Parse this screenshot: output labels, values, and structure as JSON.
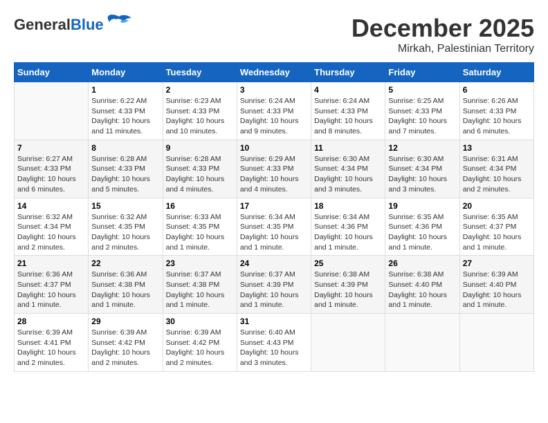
{
  "header": {
    "logo_general": "General",
    "logo_blue": "Blue",
    "main_title": "December 2025",
    "sub_title": "Mirkah, Palestinian Territory"
  },
  "calendar": {
    "days_of_week": [
      "Sunday",
      "Monday",
      "Tuesday",
      "Wednesday",
      "Thursday",
      "Friday",
      "Saturday"
    ],
    "weeks": [
      [
        {
          "day": "",
          "info": ""
        },
        {
          "day": "1",
          "info": "Sunrise: 6:22 AM\nSunset: 4:33 PM\nDaylight: 10 hours and 11 minutes."
        },
        {
          "day": "2",
          "info": "Sunrise: 6:23 AM\nSunset: 4:33 PM\nDaylight: 10 hours and 10 minutes."
        },
        {
          "day": "3",
          "info": "Sunrise: 6:24 AM\nSunset: 4:33 PM\nDaylight: 10 hours and 9 minutes."
        },
        {
          "day": "4",
          "info": "Sunrise: 6:24 AM\nSunset: 4:33 PM\nDaylight: 10 hours and 8 minutes."
        },
        {
          "day": "5",
          "info": "Sunrise: 6:25 AM\nSunset: 4:33 PM\nDaylight: 10 hours and 7 minutes."
        },
        {
          "day": "6",
          "info": "Sunrise: 6:26 AM\nSunset: 4:33 PM\nDaylight: 10 hours and 6 minutes."
        }
      ],
      [
        {
          "day": "7",
          "info": "Sunrise: 6:27 AM\nSunset: 4:33 PM\nDaylight: 10 hours and 6 minutes."
        },
        {
          "day": "8",
          "info": "Sunrise: 6:28 AM\nSunset: 4:33 PM\nDaylight: 10 hours and 5 minutes."
        },
        {
          "day": "9",
          "info": "Sunrise: 6:28 AM\nSunset: 4:33 PM\nDaylight: 10 hours and 4 minutes."
        },
        {
          "day": "10",
          "info": "Sunrise: 6:29 AM\nSunset: 4:33 PM\nDaylight: 10 hours and 4 minutes."
        },
        {
          "day": "11",
          "info": "Sunrise: 6:30 AM\nSunset: 4:34 PM\nDaylight: 10 hours and 3 minutes."
        },
        {
          "day": "12",
          "info": "Sunrise: 6:30 AM\nSunset: 4:34 PM\nDaylight: 10 hours and 3 minutes."
        },
        {
          "day": "13",
          "info": "Sunrise: 6:31 AM\nSunset: 4:34 PM\nDaylight: 10 hours and 2 minutes."
        }
      ],
      [
        {
          "day": "14",
          "info": "Sunrise: 6:32 AM\nSunset: 4:34 PM\nDaylight: 10 hours and 2 minutes."
        },
        {
          "day": "15",
          "info": "Sunrise: 6:32 AM\nSunset: 4:35 PM\nDaylight: 10 hours and 2 minutes."
        },
        {
          "day": "16",
          "info": "Sunrise: 6:33 AM\nSunset: 4:35 PM\nDaylight: 10 hours and 1 minute."
        },
        {
          "day": "17",
          "info": "Sunrise: 6:34 AM\nSunset: 4:35 PM\nDaylight: 10 hours and 1 minute."
        },
        {
          "day": "18",
          "info": "Sunrise: 6:34 AM\nSunset: 4:36 PM\nDaylight: 10 hours and 1 minute."
        },
        {
          "day": "19",
          "info": "Sunrise: 6:35 AM\nSunset: 4:36 PM\nDaylight: 10 hours and 1 minute."
        },
        {
          "day": "20",
          "info": "Sunrise: 6:35 AM\nSunset: 4:37 PM\nDaylight: 10 hours and 1 minute."
        }
      ],
      [
        {
          "day": "21",
          "info": "Sunrise: 6:36 AM\nSunset: 4:37 PM\nDaylight: 10 hours and 1 minute."
        },
        {
          "day": "22",
          "info": "Sunrise: 6:36 AM\nSunset: 4:38 PM\nDaylight: 10 hours and 1 minute."
        },
        {
          "day": "23",
          "info": "Sunrise: 6:37 AM\nSunset: 4:38 PM\nDaylight: 10 hours and 1 minute."
        },
        {
          "day": "24",
          "info": "Sunrise: 6:37 AM\nSunset: 4:39 PM\nDaylight: 10 hours and 1 minute."
        },
        {
          "day": "25",
          "info": "Sunrise: 6:38 AM\nSunset: 4:39 PM\nDaylight: 10 hours and 1 minute."
        },
        {
          "day": "26",
          "info": "Sunrise: 6:38 AM\nSunset: 4:40 PM\nDaylight: 10 hours and 1 minute."
        },
        {
          "day": "27",
          "info": "Sunrise: 6:39 AM\nSunset: 4:40 PM\nDaylight: 10 hours and 1 minute."
        }
      ],
      [
        {
          "day": "28",
          "info": "Sunrise: 6:39 AM\nSunset: 4:41 PM\nDaylight: 10 hours and 2 minutes."
        },
        {
          "day": "29",
          "info": "Sunrise: 6:39 AM\nSunset: 4:42 PM\nDaylight: 10 hours and 2 minutes."
        },
        {
          "day": "30",
          "info": "Sunrise: 6:39 AM\nSunset: 4:42 PM\nDaylight: 10 hours and 2 minutes."
        },
        {
          "day": "31",
          "info": "Sunrise: 6:40 AM\nSunset: 4:43 PM\nDaylight: 10 hours and 3 minutes."
        },
        {
          "day": "",
          "info": ""
        },
        {
          "day": "",
          "info": ""
        },
        {
          "day": "",
          "info": ""
        }
      ]
    ]
  }
}
